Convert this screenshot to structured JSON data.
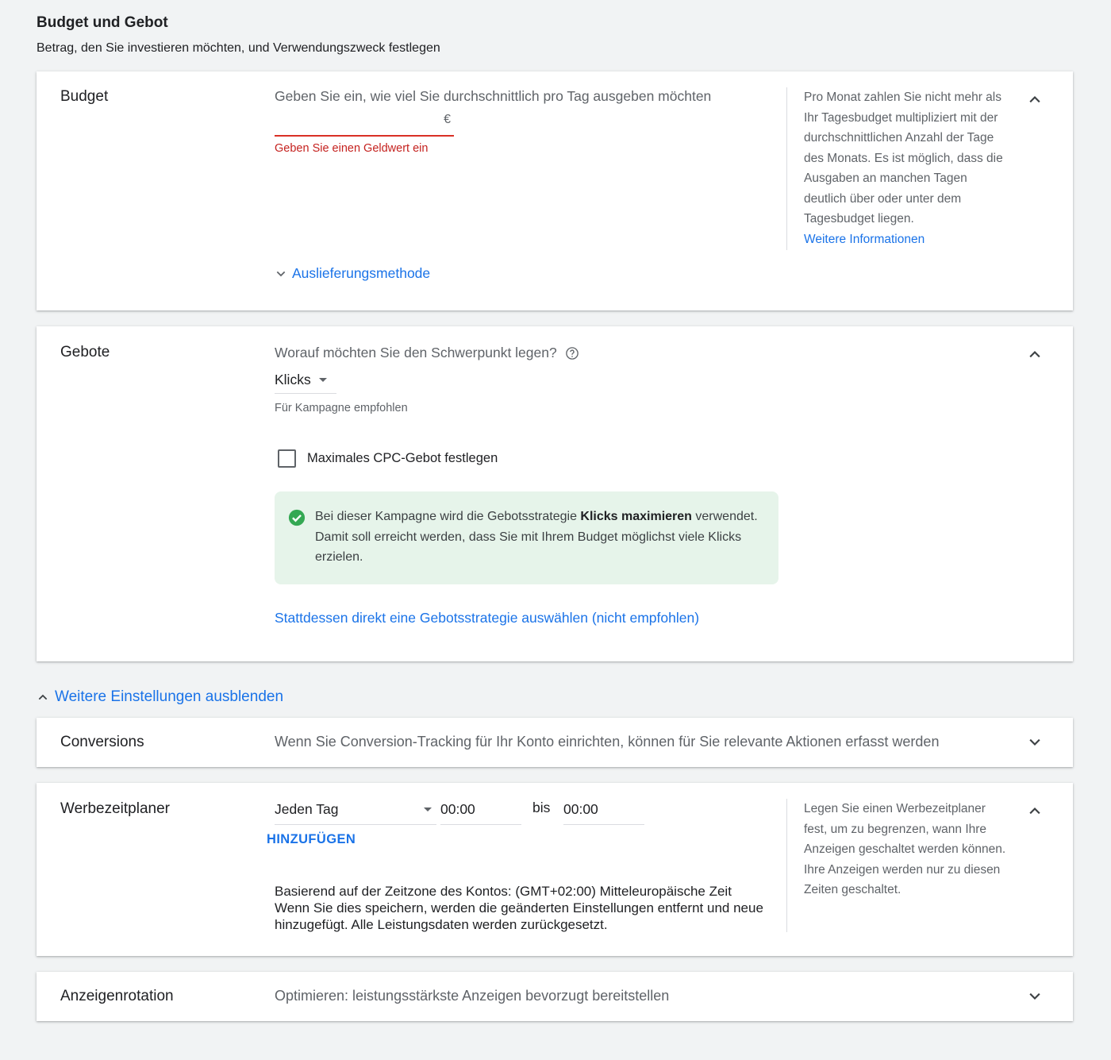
{
  "page": {
    "title": "Budget und Gebot",
    "subtitle": "Betrag, den Sie investieren möchten, und Verwendungszweck festlegen"
  },
  "budget": {
    "label": "Budget",
    "prompt": "Geben Sie ein, wie viel Sie durchschnittlich pro Tag ausgeben möchten",
    "input_value": "",
    "currency": "€",
    "error": "Geben Sie einen Geldwert ein",
    "delivery_link": "Auslieferungsmethode",
    "side_text": "Pro Monat zahlen Sie nicht mehr als Ihr Tagesbudget multipliziert mit der durchschnittlichen Anzahl der Tage des Monats. Es ist möglich, dass die Ausgaben an manchen Tagen deutlich über oder unter dem Tagesbudget liegen.",
    "side_link": "Weitere Informationen",
    "chevron_icon": "chevron-up-icon"
  },
  "bids": {
    "label": "Gebote",
    "question": "Worauf möchten Sie den Schwerpunkt legen?",
    "help_icon": "help-circle-icon",
    "selected": "Klicks",
    "hint": "Für Kampagne empfohlen",
    "cpc_checkbox_label": "Maximales CPC-Gebot festlegen",
    "cpc_checked": false,
    "info_prefix": "Bei dieser Kampagne wird die Gebotsstrategie ",
    "info_strategy": "Klicks maximieren",
    "info_suffix": " verwendet. Damit soll erreicht werden, dass Sie mit Ihrem Budget möglichst viele Klicks erzielen.",
    "strategy_link": "Stattdessen direkt eine Gebotsstrategie auswählen (nicht empfohlen)",
    "chevron_icon": "chevron-up-icon"
  },
  "more_settings": {
    "label": "Weitere Einstellungen ausblenden"
  },
  "conversions": {
    "label": "Conversions",
    "description": "Wenn Sie Conversion-Tracking für Ihr Konto einrichten, können für Sie relevante Aktionen erfasst werden",
    "chevron_icon": "chevron-down-icon"
  },
  "schedule": {
    "label": "Werbezeitplaner",
    "day": "Jeden Tag",
    "from": "00:00",
    "bis": "bis",
    "to": "00:00",
    "add": "HINZUFÜGEN",
    "timezone": "Basierend auf der Zeitzone des Kontos: (GMT+02:00) Mitteleuropäische Zeit",
    "warning": "Wenn Sie dies speichern, werden die geänderten Einstellungen entfernt und neue hinzugefügt. Alle Leistungsdaten werden zurückgesetzt.",
    "side_text": "Legen Sie einen Werbezeitplaner fest, um zu begrenzen, wann Ihre Anzeigen geschaltet werden können. Ihre Anzeigen werden nur zu diesen Zeiten geschaltet.",
    "chevron_icon": "chevron-up-icon"
  },
  "rotation": {
    "label": "Anzeigenrotation",
    "description": "Optimieren: leistungsstärkste Anzeigen bevorzugt bereitstellen",
    "chevron_icon": "chevron-down-icon"
  },
  "colors": {
    "link": "#1a73e8",
    "error": "#d93025",
    "success": "#34a853",
    "info_bg": "#e6f4ea"
  }
}
